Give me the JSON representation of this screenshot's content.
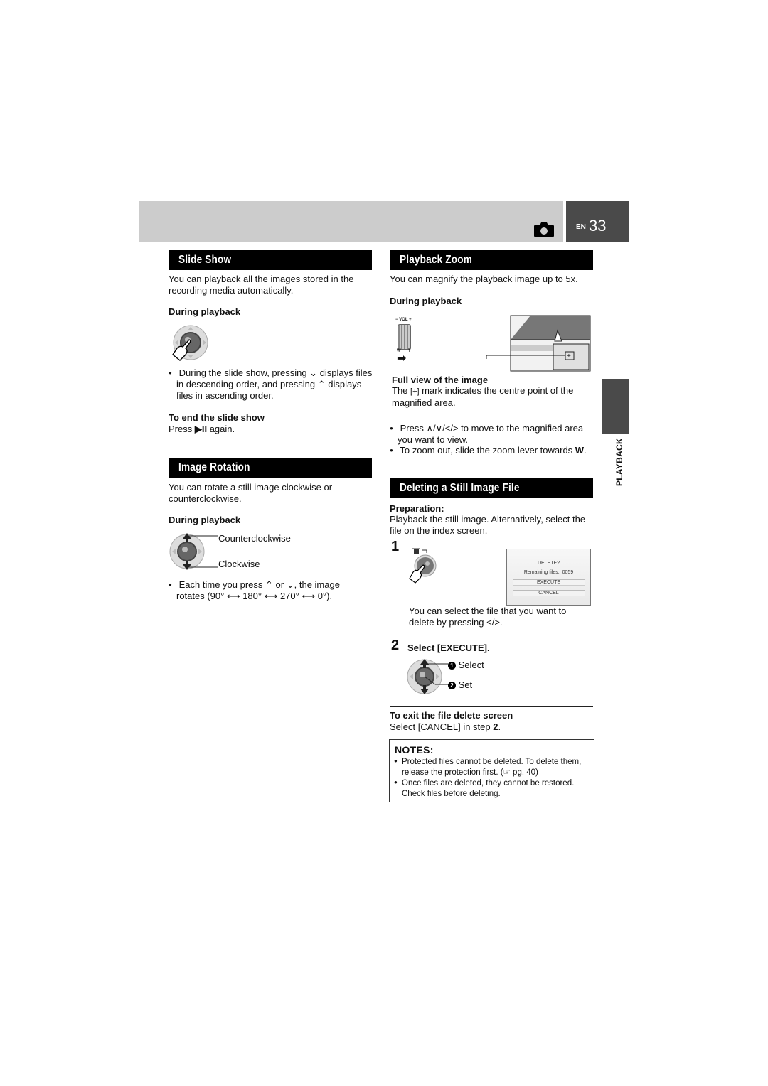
{
  "header": {
    "lang": "EN",
    "page_number": "33",
    "mode_icon": "camera-icon",
    "colors": {
      "band": "#cccccc",
      "page_box": "#4a4a4a"
    }
  },
  "side_tab": {
    "label": "PLAYBACK"
  },
  "slide_show": {
    "title": "Slide Show",
    "intro": "You can playback all the images stored in the recording media automatically.",
    "during": "During playback",
    "bullet": [
      "During the slide show, pressing ",
      " displays files in descending order, and pressing ",
      " displays files in ascending order."
    ],
    "end_heading": "To end the slide show",
    "end_text_pre": "Press ",
    "end_key": "▶II",
    "end_text_post": " again."
  },
  "image_rotation": {
    "title": "Image Rotation",
    "intro": "You can rotate a still image clockwise or counterclockwise.",
    "during": "During playback",
    "label_ccw": "Counterclockwise",
    "label_cw": "Clockwise",
    "bullet_a": "Each time you press ",
    "bullet_or": " or ",
    "bullet_b": ", the image",
    "bullet_c": "rotates (90° ⟷ 180° ⟷ 270° ⟷ 0°)."
  },
  "playback_zoom": {
    "title": "Playback Zoom",
    "intro": "You can magnify the playback image up to 5x.",
    "during": "During playback",
    "lever_top": "− VOL +",
    "lever_w": "W",
    "lever_t": "T",
    "full_view_heading": "Full view of the image",
    "full_view_pre": "The ",
    "full_view_post": " mark indicates the centre point of the magnified area.",
    "bullet1_pre": "Press ",
    "bullet1_keys": "∧/∨/</>",
    "bullet1_post": " to move to the magnified area you want to view.",
    "bullet2_pre": "To zoom out, slide the zoom lever towards ",
    "bullet2_key": "W",
    "bullet2_post": "."
  },
  "delete_still": {
    "title": "Deleting a Still Image File",
    "prep_heading": "Preparation:",
    "prep_text": "Playback the still image. Alternatively, select the file on the index screen.",
    "step1_num": "1",
    "lcd": {
      "title": "DELETE?",
      "remaining_label": "Remaining files:",
      "remaining_value": "0059",
      "execute": "EXECUTE",
      "cancel": "CANCEL"
    },
    "step1_text_pre": "You can select the file that you want to delete by pressing ",
    "step1_keys": "</>",
    "step1_text_post": ".",
    "step2_num": "2",
    "step2_text": "Select [EXECUTE].",
    "label_select": "Select",
    "label_set": "Set",
    "badge1": "1",
    "badge2": "2",
    "exit_heading": "To exit the file delete screen",
    "exit_text_pre": "Select [CANCEL] in step ",
    "exit_step": "2",
    "exit_text_post": "."
  },
  "notes": {
    "title": "NOTES:",
    "items": [
      "Protected files cannot be deleted. To delete them, release the protection first. (☞ pg. 40)",
      "Once files are deleted, they cannot be restored. Check files before deleting."
    ]
  }
}
